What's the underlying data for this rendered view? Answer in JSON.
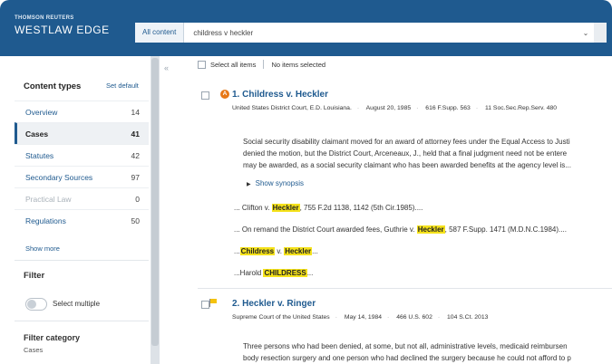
{
  "brand": {
    "top": "THOMSON REUTERS",
    "main": "WESTLAW EDGE"
  },
  "search": {
    "scope": "All content",
    "query": "childress v heckler"
  },
  "sidebar": {
    "content_types_label": "Content types",
    "set_default_label": "Set default",
    "items": [
      {
        "label": "Overview",
        "count": "14"
      },
      {
        "label": "Cases",
        "count": "41"
      },
      {
        "label": "Statutes",
        "count": "42"
      },
      {
        "label": "Secondary Sources",
        "count": "97"
      },
      {
        "label": "Practical Law",
        "count": "0"
      },
      {
        "label": "Regulations",
        "count": "50"
      }
    ],
    "show_more_label": "Show more",
    "filter_label": "Filter",
    "select_multiple_label": "Select multiple",
    "filter_category_label": "Filter category",
    "filter_category_value": "Cases"
  },
  "results_bar": {
    "select_all_label": "Select all items",
    "selected_status": "No items selected"
  },
  "results": [
    {
      "badge": "A",
      "number": "1.",
      "title": "Childress v. Heckler",
      "court": "United States District Court, E.D. Louisiana.",
      "date": "August 20, 1985",
      "cite1": "616 F.Supp. 563",
      "cite2": "11 Soc.Sec.Rep.Serv. 480",
      "synopsis_lines": [
        "Social security disability claimant moved for an award of attorney fees under the Equal Access to Justi",
        "denied the motion, but the District Court, Arceneaux, J., held that a final judgment need not be entere",
        "may be awarded, as a social security claimant who has been awarded benefits at the agency level is..."
      ],
      "show_synopsis_label": "Show synopsis",
      "snippets": [
        {
          "pre": "... Clifton v. ",
          "hl": "Heckler",
          "post": ", 755 F.2d 1138, 1142 (5th Cir.1985)...."
        },
        {
          "pre": "... On remand the District Court awarded fees, Guthrie v. ",
          "hl": "Heckler",
          "post": ", 587 F.Supp. 1471 (M.D.N.C.1984)...."
        },
        {
          "pre": "...",
          "hl": "Childress",
          "mid": " v. ",
          "hl2": "Heckler",
          "post": "..."
        },
        {
          "pre": "...Harold ",
          "hl": "CHILDRESS",
          "post": "..."
        }
      ]
    },
    {
      "number": "2.",
      "title": "Heckler v. Ringer",
      "court": "Supreme Court of the United States",
      "date": "May 14, 1984",
      "cite1": "466 U.S. 602",
      "cite2": "104 S.Ct. 2013",
      "synopsis_lines": [
        "Three persons who had been denied, at some, but not all, administrative levels, medicaid reimbursen",
        "body resection surgery and one person who had declined the surgery because he could not afford to p"
      ]
    }
  ],
  "colors": {
    "header": "#1f5a8f",
    "link": "#1f5a8f",
    "highlight": "#f5e21b",
    "badge": "#e77817",
    "flag": "#f4c20d"
  }
}
